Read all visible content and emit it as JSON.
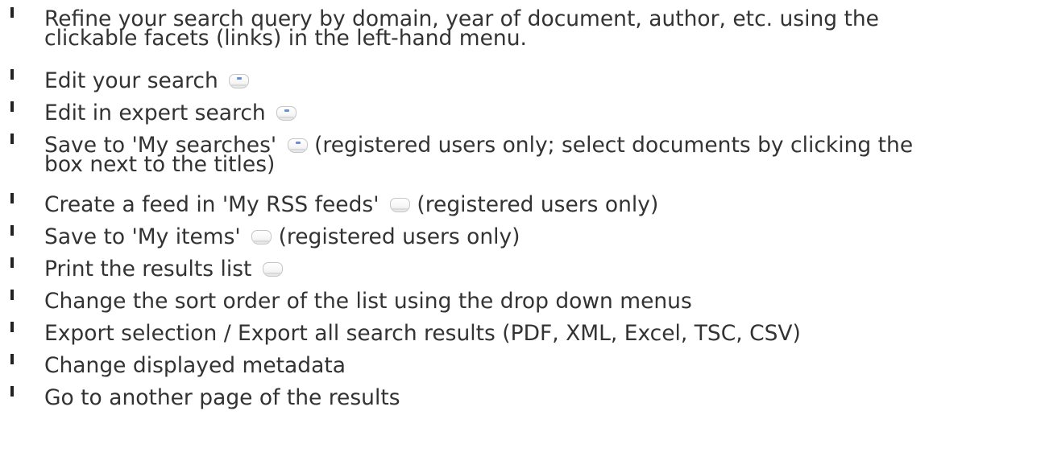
{
  "help_items": {
    "refine_line1": "Refine your search query by domain, year of document, author, etc. using the",
    "refine_line2": "clickable facets (links) in the left-hand menu.",
    "edit_search": "Edit your search",
    "edit_expert": "Edit in expert search",
    "save_searches_line1": "Save to 'My searches'",
    "save_searches_line1_after": "(registered users only; select documents by clicking the",
    "save_searches_line2": "box next to the titles)",
    "create_feed": "Create a feed in 'My RSS feeds'",
    "create_feed_after": "(registered users only)",
    "save_items": "Save to 'My items'",
    "save_items_after": "(registered users only)",
    "print_results": "Print the results list",
    "change_sort": "Change the sort order of the list using the drop down menus",
    "export": "Export selection / Export all search results (PDF, XML, Excel, TSC, CSV)",
    "change_metadata": "Change displayed metadata",
    "goto_page": "Go to another page of the results"
  },
  "icons": {
    "edit_search": "edit-search-icon",
    "edit_expert": "expert-search-icon",
    "save_searches": "save-search-icon",
    "rss_feed": "rss-feed-icon",
    "save_items": "save-items-icon",
    "print": "print-icon"
  }
}
